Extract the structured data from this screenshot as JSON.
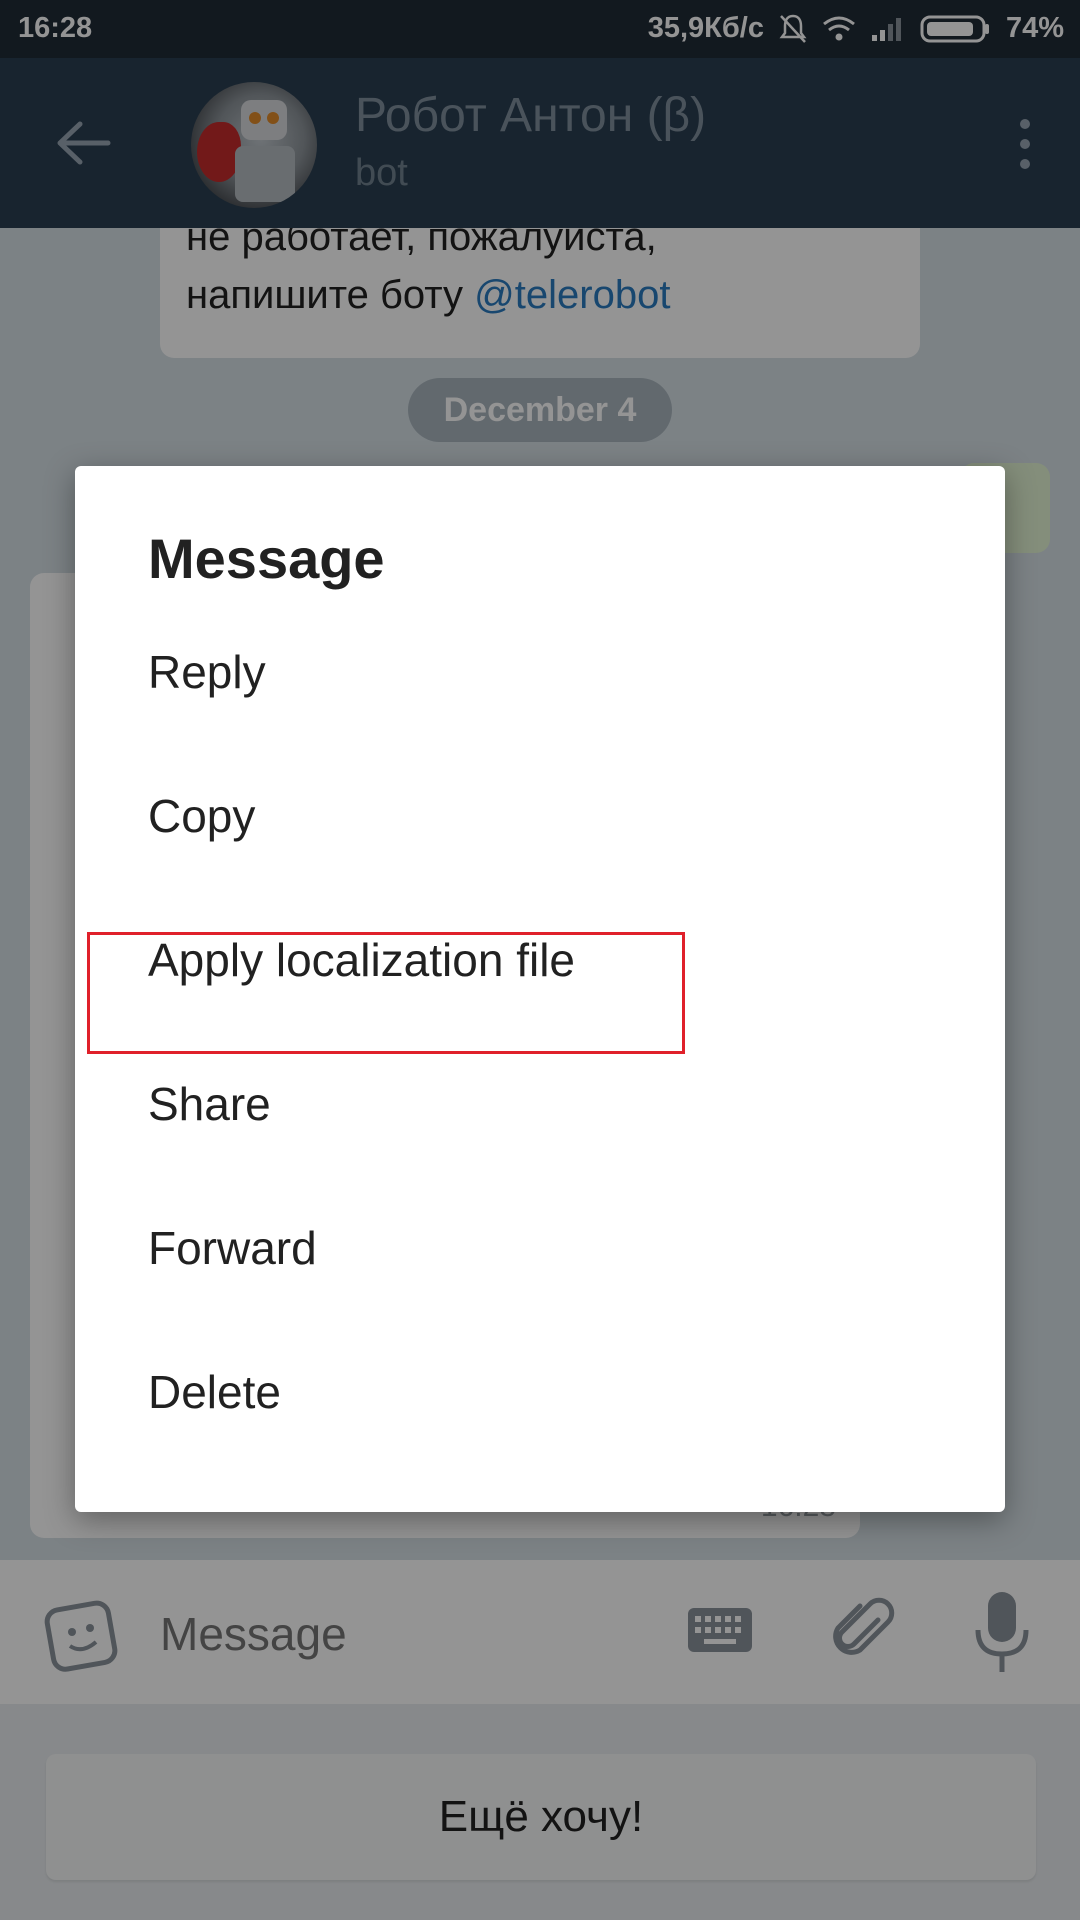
{
  "status_bar": {
    "time": "16:28",
    "network_speed": "35,9Кб/с",
    "battery": "74%"
  },
  "header": {
    "title": "Робот Антон (β)",
    "subtitle": "bot"
  },
  "chat": {
    "top_bubble_line1": "не работает, пожалуйста,",
    "top_bubble_line2_prefix": "напишите боту ",
    "top_bubble_link": "@telerobot",
    "date_pill": "December 4",
    "timestamp": "16:28"
  },
  "composer": {
    "placeholder": "Message"
  },
  "bot_keyboard": {
    "button_label": "Ещё хочу!"
  },
  "dialog": {
    "title": "Message",
    "items": [
      {
        "label": "Reply"
      },
      {
        "label": "Copy"
      },
      {
        "label": "Apply localization file"
      },
      {
        "label": "Share"
      },
      {
        "label": "Forward"
      },
      {
        "label": "Delete"
      }
    ]
  },
  "colors": {
    "header_bg": "#2a3f52",
    "status_bar_bg": "#1f2b36",
    "link": "#2a7bbf",
    "highlight_border": "#e0202a"
  }
}
